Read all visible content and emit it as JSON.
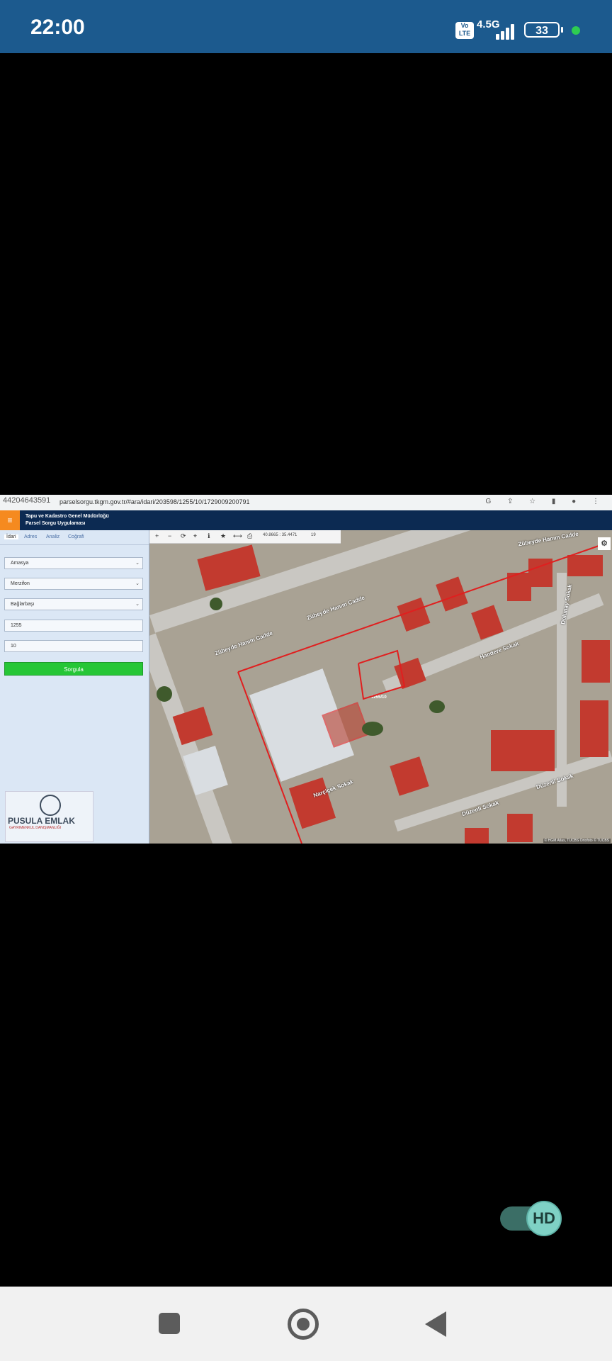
{
  "status_bar": {
    "time": "22:00",
    "volte": "Vo LTE",
    "network": "4.5G",
    "battery": "33"
  },
  "screenshot": {
    "overlay_number": "44204643591",
    "url": "parselsorgu.tkgm.gov.tr/#ara/idari/203598/1255/10/1729009200791",
    "app_title_line1": "Tapu ve Kadastro Genel Müdürlüğü",
    "app_title_line2": "Parsel Sorgu Uygulaması",
    "tabs": [
      "İdari",
      "Adres",
      "Analiz",
      "Coğrafi"
    ],
    "fields": {
      "province": "Amasya",
      "district": "Merzifon",
      "neighborhood": "Bağlarbaşı",
      "block": "1255",
      "parcel": "10"
    },
    "query_button": "Sorgula",
    "map": {
      "coords": "40.8665 : 35.4471",
      "zoom": "19",
      "parcel_label": "1255/10",
      "streets": [
        "Zübeyde Hanım Cadde",
        "Zübeyde Hanım Cadde",
        "Zübeyde Hanım Cadde",
        "Dolunay Sokak",
        "Handere Sokak",
        "Narçiçek Sokak",
        "Düzenli Sokak",
        "Düzenli Sokak"
      ],
      "attribution": "© HGM Atlas, TUCBS Ortofoto © TUCBS"
    },
    "logo": {
      "brand": "PUSULA EMLAK",
      "tagline": "GAYRIMENKUL DANIŞMANLIĞI"
    }
  },
  "hd_toggle": {
    "label": "HD"
  }
}
